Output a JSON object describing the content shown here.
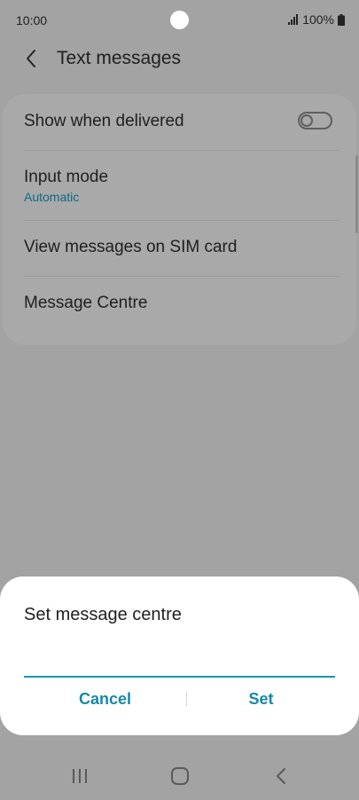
{
  "status_bar": {
    "time": "10:00",
    "battery_text": "100%",
    "icons": [
      "camera-cutout",
      "signal-icon",
      "battery-icon"
    ]
  },
  "header": {
    "title": "Text messages",
    "back_icon": "chevron-left-icon"
  },
  "settings": {
    "show_when_delivered": {
      "label": "Show when delivered",
      "toggle_on": false
    },
    "input_mode": {
      "label": "Input mode",
      "value": "Automatic"
    },
    "view_sim_messages": {
      "label": "View messages on SIM card"
    },
    "message_centre": {
      "label": "Message Centre"
    }
  },
  "dialog": {
    "title": "Set message centre",
    "input_value": "",
    "cancel_label": "Cancel",
    "set_label": "Set"
  },
  "navigation": {
    "icons": [
      "recents-icon",
      "home-icon",
      "back-icon"
    ]
  },
  "colors": {
    "accent": "#1688a8",
    "sublabel": "#0d6a86",
    "scrim": "#a3a3a3",
    "dialog_bg": "#ffffff"
  }
}
